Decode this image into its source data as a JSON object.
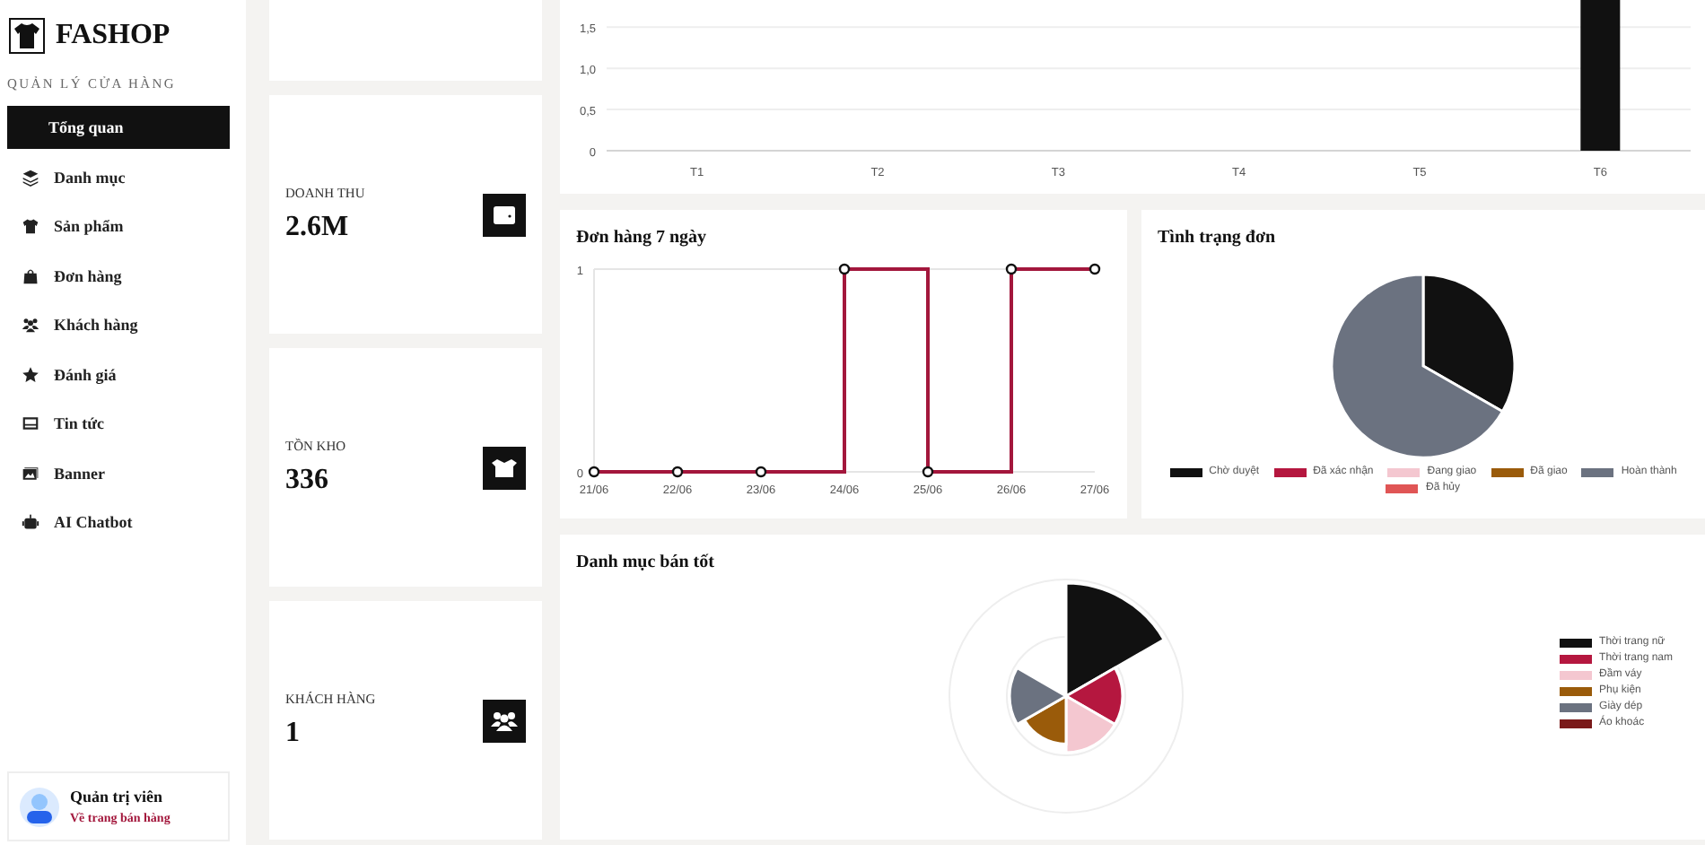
{
  "sidebar": {
    "brand": "FASHOP",
    "section_label": "QUẢN LÝ CỬA HÀNG",
    "items": [
      {
        "label": "Tổng quan",
        "selected": true
      },
      {
        "label": "Danh mục",
        "selected": false
      },
      {
        "label": "Sản phẩm",
        "selected": false
      },
      {
        "label": "Đơn hàng",
        "selected": false
      },
      {
        "label": "Khách hàng",
        "selected": false
      },
      {
        "label": "Đánh giá",
        "selected": false
      },
      {
        "label": "Tin tức",
        "selected": false
      },
      {
        "label": "Banner",
        "selected": false
      },
      {
        "label": "AI Chatbot",
        "selected": false
      }
    ],
    "user": {
      "name": "Quản trị viên",
      "link": "Về trang bán hàng"
    }
  },
  "stats": [
    {
      "label": "DOANH THU",
      "value": "2.6M"
    },
    {
      "label": "TỒN KHO",
      "value": "336"
    },
    {
      "label": "KHÁCH HÀNG",
      "value": "1"
    }
  ],
  "monthly_chart": {
    "chart_data": {
      "type": "bar",
      "categories": [
        "T1",
        "T2",
        "T3",
        "T4",
        "T5",
        "T6"
      ],
      "series": [
        {
          "color": "#111111",
          "values": [
            0,
            0,
            0,
            0,
            0,
            1.83
          ]
        }
      ],
      "ylim": [
        0,
        1.83
      ],
      "grid": true,
      "yticks": [
        {
          "value": 0,
          "label": "0"
        },
        {
          "value": 0.5,
          "label": "0,5"
        },
        {
          "value": 1,
          "label": "1,0"
        },
        {
          "value": 1.5,
          "label": "1,5"
        }
      ]
    }
  },
  "orders_7_days": {
    "title": "Đơn hàng 7 ngày",
    "chart_data": {
      "type": "step",
      "categories": [
        "21/06",
        "22/06",
        "23/06",
        "24/06",
        "25/06",
        "26/06",
        "27/06"
      ],
      "series": [
        {
          "color": "#a3173c",
          "values": [
            0,
            0,
            0,
            1,
            0,
            1,
            1
          ],
          "marker": "circle"
        }
      ],
      "ylim": [
        0,
        1
      ],
      "yticks": [
        {
          "value": 0,
          "label": "0"
        },
        {
          "value": 1,
          "label": "1"
        }
      ]
    }
  },
  "order_status": {
    "title": "Tình trạng đơn",
    "chart_data": {
      "type": "pie",
      "categories": [
        "Chờ duyệt",
        "Đã xác nhận",
        "Đang giao",
        "Đã giao",
        "Hoàn thành",
        "Đã hủy"
      ],
      "values": [
        33.3,
        0,
        0,
        0,
        66.7,
        0
      ],
      "colors": [
        "#111111",
        "#b5173f",
        "#f4c7d0",
        "#9a5b0a",
        "#6b7280",
        "#e05555"
      ],
      "legend": true
    }
  },
  "top_categories": {
    "title": "Danh mục bán tốt",
    "legend": [
      {
        "label": "Thời trang nữ",
        "color": "#111111"
      },
      {
        "label": "Thời trang nam",
        "color": "#b5173f"
      },
      {
        "label": "Đầm váy",
        "color": "#f4c7d0"
      },
      {
        "label": "Phụ kiện",
        "color": "#9a5b0a"
      },
      {
        "label": "Giày dép",
        "color": "#6b7280"
      },
      {
        "label": "Áo khoác",
        "color": "#7a1a1a"
      }
    ]
  }
}
